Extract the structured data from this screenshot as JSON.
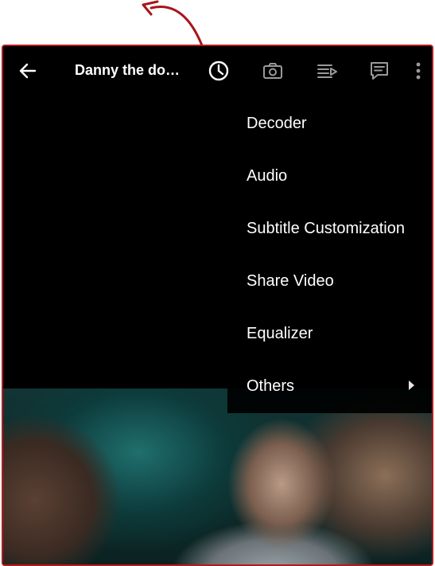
{
  "toolbar": {
    "title": "Danny the do…",
    "icons": [
      "back-arrow-icon",
      "timer-icon",
      "camera-icon",
      "playlist-icon",
      "subtitle-icon",
      "more-vert-icon"
    ]
  },
  "menu": {
    "items": [
      {
        "label": "Decoder",
        "has_submenu": false
      },
      {
        "label": "Audio",
        "has_submenu": false
      },
      {
        "label": "Subtitle Customization",
        "has_submenu": false
      },
      {
        "label": "Share Video",
        "has_submenu": false
      },
      {
        "label": "Equalizer",
        "has_submenu": false
      },
      {
        "label": "Others",
        "has_submenu": true
      }
    ]
  },
  "colors": {
    "frame_border": "#b01c1c",
    "annotation": "#a8141a",
    "background": "#000000",
    "text": "#ffffff",
    "icon_active": "#ffffff",
    "icon_inactive": "#9a9a9a"
  }
}
